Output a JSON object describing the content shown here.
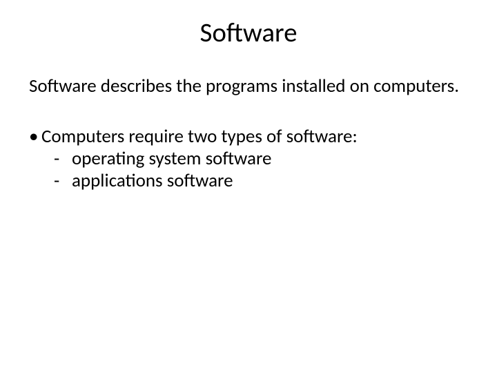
{
  "title": "Software",
  "intro": "Software describes the programs installed on computers.",
  "bullet": "Computers require two types of software:",
  "sub1": " operating system software",
  "sub2": "applications software"
}
